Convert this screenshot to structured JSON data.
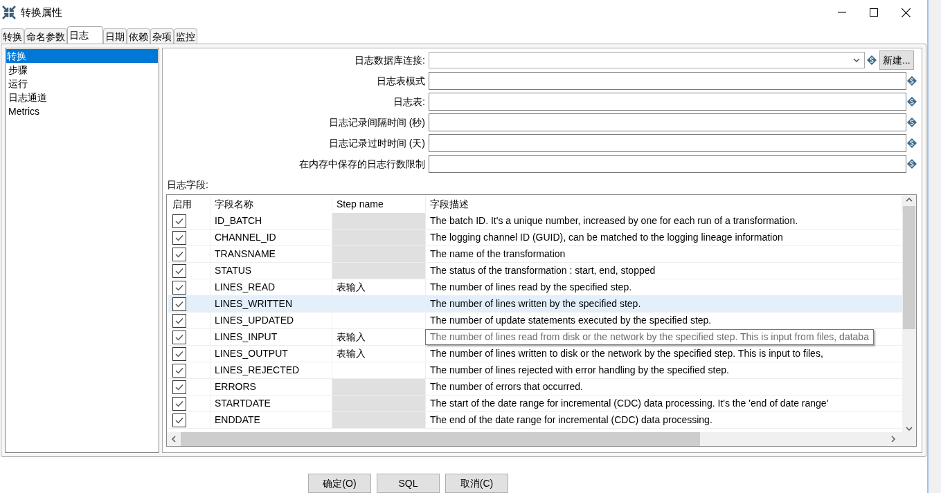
{
  "window": {
    "title": "转换属性"
  },
  "tabs": [
    {
      "label": "转换",
      "selected": false
    },
    {
      "label": "命名参数",
      "selected": false
    },
    {
      "label": "日志",
      "selected": true
    },
    {
      "label": "日期",
      "selected": false
    },
    {
      "label": "依赖",
      "selected": false
    },
    {
      "label": "杂项",
      "selected": false
    },
    {
      "label": "监控",
      "selected": false
    }
  ],
  "sidebar": {
    "items": [
      {
        "label": "转换",
        "selected": true
      },
      {
        "label": "步骤",
        "selected": false
      },
      {
        "label": "运行",
        "selected": false
      },
      {
        "label": "日志通道",
        "selected": false
      },
      {
        "label": "Metrics",
        "selected": false
      }
    ]
  },
  "form": {
    "fields": [
      {
        "kind": "combo",
        "label": "日志数据库连接:",
        "button": "新建..."
      },
      {
        "kind": "text",
        "label": "日志表模式"
      },
      {
        "kind": "text",
        "label": "日志表:"
      },
      {
        "kind": "text",
        "label": "日志记录间隔时间 (秒)"
      },
      {
        "kind": "text",
        "label": "日志记录过时时间 (天)"
      },
      {
        "kind": "text",
        "label": "在内存中保存的日志行数限制"
      }
    ]
  },
  "log_fields": {
    "label": "日志字段:",
    "columns": [
      "启用",
      "字段名称",
      "Step name",
      "字段描述"
    ],
    "rows": [
      {
        "checked": true,
        "selected": false,
        "name": "ID_BATCH",
        "step_disabled": true,
        "description": "The batch ID. It's a unique number, increased by one for each run of a transformation."
      },
      {
        "checked": true,
        "selected": false,
        "name": "CHANNEL_ID",
        "step_disabled": true,
        "description": "The logging channel ID (GUID), can be matched to the logging lineage information"
      },
      {
        "checked": true,
        "selected": false,
        "name": "TRANSNAME",
        "step_disabled": true,
        "description": "The name of the transformation"
      },
      {
        "checked": true,
        "selected": false,
        "name": "STATUS",
        "step_disabled": true,
        "description": "The status of the transformation : start, end, stopped"
      },
      {
        "checked": true,
        "selected": false,
        "name": "LINES_READ",
        "step_disabled": false,
        "step": "表输入",
        "description": "The number of lines read by the specified step."
      },
      {
        "checked": true,
        "selected": true,
        "name": "LINES_WRITTEN",
        "step_disabled": false,
        "description": "The number of lines written by the specified step."
      },
      {
        "checked": true,
        "selected": false,
        "name": "LINES_UPDATED",
        "step_disabled": false,
        "description": "The number of update statements executed by the specified step."
      },
      {
        "checked": true,
        "selected": false,
        "name": "LINES_INPUT",
        "step_disabled": false,
        "step": "表输入",
        "tooltip": true,
        "description": "The number of lines read from disk or the network by the specified step. This is input from files, databa"
      },
      {
        "checked": true,
        "selected": false,
        "name": "LINES_OUTPUT",
        "step_disabled": false,
        "step": "表输入",
        "description": "The number of lines written to disk or the network by the specified step. This is input to files,"
      },
      {
        "checked": true,
        "selected": false,
        "name": "LINES_REJECTED",
        "step_disabled": false,
        "description": "The number of lines rejected with error handling by the specified step."
      },
      {
        "checked": true,
        "selected": false,
        "name": "ERRORS",
        "step_disabled": true,
        "description": "The number of errors that occurred."
      },
      {
        "checked": true,
        "selected": false,
        "name": "STARTDATE",
        "step_disabled": true,
        "description": "The start of the date range for incremental (CDC) data processing. It's the 'end of date range'"
      },
      {
        "checked": true,
        "selected": false,
        "name": "ENDDATE",
        "step_disabled": true,
        "description": "The end of the date range for incremental (CDC) data processing."
      }
    ]
  },
  "buttons": [
    "确定(O)",
    "SQL",
    "取消(C)"
  ]
}
